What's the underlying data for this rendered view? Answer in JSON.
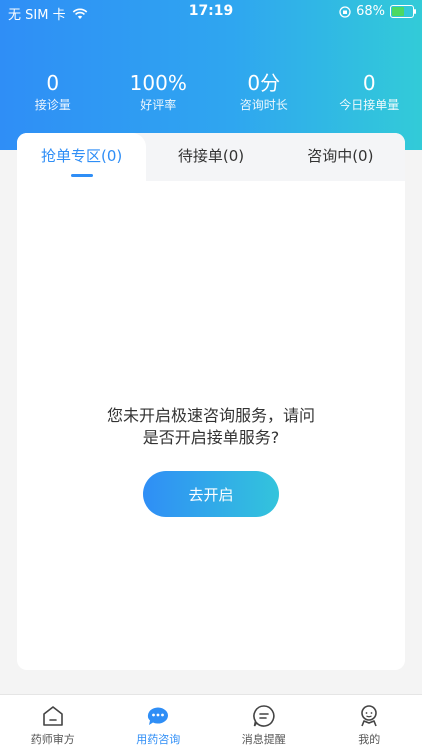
{
  "status_bar": {
    "carrier": "无 SIM 卡",
    "time": "17:19",
    "battery": "68%"
  },
  "stats": [
    {
      "value": "0",
      "label": "接诊量"
    },
    {
      "value": "100%",
      "label": "好评率"
    },
    {
      "value": "0分",
      "label": "咨询时长"
    },
    {
      "value": "0",
      "label": "今日接单量"
    }
  ],
  "tabs": [
    {
      "label": "抢单专区(0)",
      "active": true
    },
    {
      "label": "待接单(0)",
      "active": false
    },
    {
      "label": "咨询中(0)",
      "active": false
    }
  ],
  "empty_state": {
    "line1": "您未开启极速咨询服务，请问",
    "line2": "是否开启接单服务?",
    "button": "去开启"
  },
  "bottom_nav": [
    {
      "label": "药师审方",
      "icon": "home-icon"
    },
    {
      "label": "用药咨询",
      "icon": "chat-icon",
      "active": true
    },
    {
      "label": "消息提醒",
      "icon": "message-icon"
    },
    {
      "label": "我的",
      "icon": "profile-icon"
    }
  ],
  "colors": {
    "primary": "#2f8ef6",
    "accent": "#32cbd8",
    "battery": "#4cd964"
  }
}
